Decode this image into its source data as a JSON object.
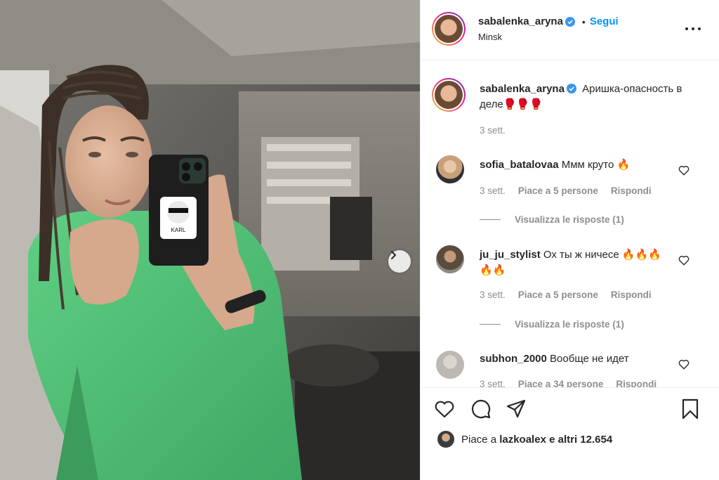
{
  "post": {
    "photo_alt": "mirror selfie",
    "phone_case_text": "KARL",
    "header": {
      "username": "sabalenka_aryna",
      "separator": "•",
      "follow_label": "Segui",
      "location": "Minsk"
    },
    "caption": {
      "username": "sabalenka_aryna",
      "text": "Аришка-опасность в деле🥊🥊🥊",
      "time": "3 sett."
    },
    "comments": [
      {
        "username": "sofia_batalovaa",
        "text": "Ммм круто 🔥",
        "time": "3 sett.",
        "likes": "Piace a 5 persone",
        "reply": "Rispondi",
        "view_replies": "Visualizza le risposte (1)"
      },
      {
        "username": "ju_ju_stylist",
        "text": "Ох ты ж ничесе 🔥🔥🔥🔥🔥",
        "time": "3 sett.",
        "likes": "Piace a 5 persone",
        "reply": "Rispondi",
        "view_replies": "Visualizza le risposte (1)"
      },
      {
        "username": "subhon_2000",
        "text": "Вообще не идет",
        "time": "3 sett.",
        "likes": "Piace a 34 persone",
        "reply": "Rispondi"
      }
    ],
    "likes_line": {
      "prefix": "Piace a ",
      "user": "lazkoalex",
      "suffix": " e altri 12.654"
    },
    "colors": {
      "follow": "#0095f6",
      "secondary": "#8e8e8e",
      "primary": "#262626",
      "verified": "#3897f0"
    },
    "icons": [
      "heart-icon",
      "comment-icon",
      "share-icon",
      "bookmark-icon",
      "more-icon",
      "next-arrow-icon",
      "verified-badge-icon"
    ]
  }
}
